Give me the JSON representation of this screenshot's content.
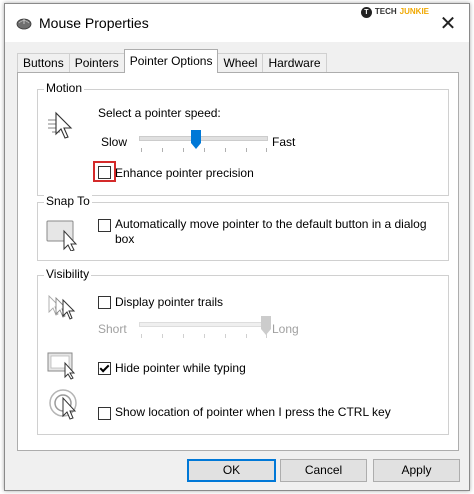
{
  "window": {
    "title": "Mouse Properties",
    "close_glyph": "✕",
    "watermark": {
      "badge": "T",
      "tech": "TECH",
      "junkie": "JUNKIE"
    }
  },
  "tabs": [
    {
      "label": "Buttons",
      "active": false
    },
    {
      "label": "Pointers",
      "active": false
    },
    {
      "label": "Pointer Options",
      "active": true
    },
    {
      "label": "Wheel",
      "active": false
    },
    {
      "label": "Hardware",
      "active": false
    }
  ],
  "motion": {
    "legend": "Motion",
    "speed_label": "Select a pointer speed:",
    "slow_label": "Slow",
    "fast_label": "Fast",
    "speed_level": 0.45,
    "precision_label": "Enhance pointer precision",
    "precision_checked": false,
    "icon": "pointer-speed-icon"
  },
  "snap_to": {
    "legend": "Snap To",
    "label": "Automatically move pointer to the default button in a dialog box",
    "label_line1": "Automatically move pointer to the default button in a dialog",
    "label_line2": "box",
    "checked": false,
    "icon": "snap-to-default-icon"
  },
  "visibility": {
    "legend": "Visibility",
    "trails_label": "Display pointer trails",
    "trails_checked": false,
    "short_label": "Short",
    "long_label": "Long",
    "trails_level": 1.0,
    "hide_label": "Hide pointer while typing",
    "hide_checked": true,
    "ctrl_label": "Show location of pointer when I press the CTRL key",
    "ctrl_checked": false,
    "icons": [
      "pointer-trails-icon",
      "hide-pointer-icon",
      "ctrl-locate-icon"
    ]
  },
  "buttons": {
    "ok": "OK",
    "cancel": "Cancel",
    "apply": "Apply"
  },
  "colors": {
    "accent": "#0078d7",
    "highlight": "#d42a2a",
    "disabled_text": "#a0a0a0",
    "panel": "#ffffff",
    "chrome": "#f0f0f0"
  }
}
